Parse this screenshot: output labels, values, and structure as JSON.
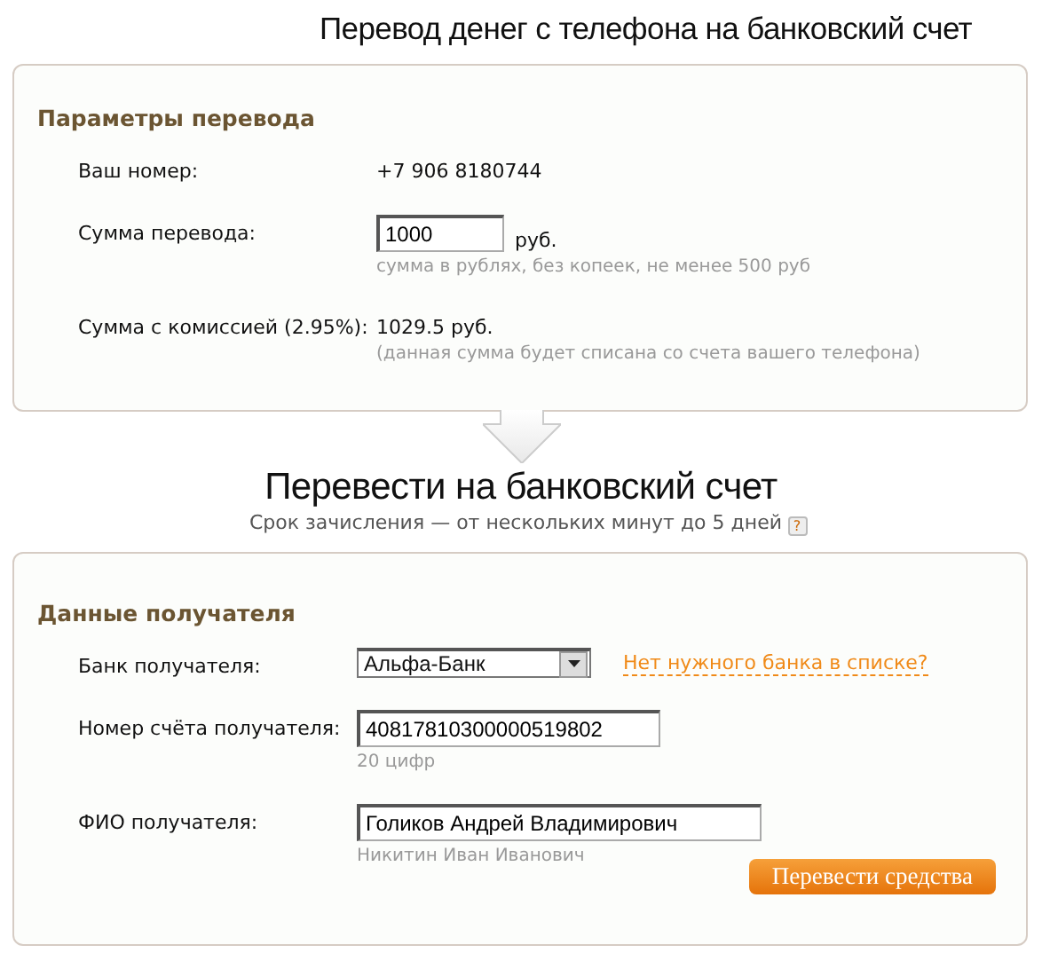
{
  "page_title": "Перевод денег с телефона на банковский счет",
  "params": {
    "heading": "Параметры перевода",
    "rows": [
      {
        "kind": "text",
        "label": "Ваш номер:",
        "value": "+7 906 8180744"
      },
      {
        "kind": "input",
        "label": "Сумма перевода:",
        "value": "1000",
        "unit": "руб.",
        "hint": "сумма в рублях, без копеек, не менее 500 руб"
      },
      {
        "kind": "text",
        "label": "Сумма с комиссией (2.95%):",
        "value": "1029.5 руб.",
        "hint": "(данная сумма будет списана со счета вашего телефона)"
      }
    ]
  },
  "transfer": {
    "title": "Перевести на банковский счет",
    "subtitle": "Срок зачисления — от нескольких минут до 5 дней",
    "help": "?"
  },
  "recipient": {
    "heading": "Данные получателя",
    "rows": [
      {
        "kind": "select",
        "label": "Банк получателя:",
        "value": "Альфа-Банк",
        "link": "Нет нужного банка в списке?"
      },
      {
        "kind": "input",
        "label": "Номер счёта получателя:",
        "value": "40817810300000519802",
        "hint": "20 цифр"
      },
      {
        "kind": "input",
        "label": "ФИО получателя:",
        "value": "Голиков Андрей Владимирович",
        "hint": "Никитин Иван Иванович"
      }
    ],
    "submit": "Перевести средства"
  }
}
